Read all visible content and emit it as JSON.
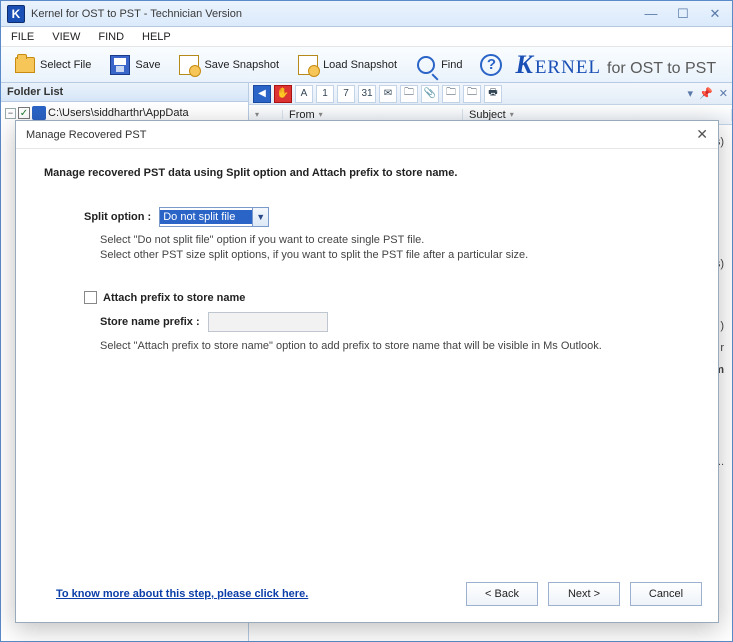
{
  "window": {
    "title": "Kernel for OST to PST - Technician Version",
    "app_icon_letter": "K"
  },
  "menu": {
    "items": [
      "FILE",
      "VIEW",
      "FIND",
      "HELP"
    ]
  },
  "toolbar": {
    "select_file": "Select File",
    "save": "Save",
    "save_snapshot": "Save Snapshot",
    "load_snapshot": "Load Snapshot",
    "find": "Find",
    "help_glyph": "?",
    "brand_first": "K",
    "brand_rest": "ERNEL",
    "brand_for": "for OST to PST"
  },
  "left_pane": {
    "header": "Folder List",
    "node_toggle": "−",
    "node_check": "✓",
    "node_text": "C:\\Users\\siddharthr\\AppData"
  },
  "right_pane": {
    "cols": {
      "from": "From",
      "subject": "Subject"
    },
    "ghost_items": [
      "iles)",
      "rvers)",
      "ino )",
      "r",
      "ed Em",
      "",
      "atlo..."
    ]
  },
  "mini_icons": [
    "◀",
    "✋",
    "A",
    "1",
    "7",
    "31",
    "✉",
    "🗀",
    "📎",
    "🗀",
    "🗀",
    "🖶"
  ],
  "rtools": [
    "▾",
    "📌",
    "✕"
  ],
  "dialog": {
    "title": "Manage Recovered PST",
    "heading": "Manage recovered PST data using Split option and Attach prefix to store name.",
    "split_label": "Split option :",
    "split_value": "Do not split file",
    "hint1_l1": "Select \"Do not split file\" option if you want to create single PST file.",
    "hint1_l2": "Select other PST size split options, if you want to split the PST file after a particular size.",
    "attach_prefix_label": "Attach prefix to store name",
    "store_prefix_label": "Store name prefix :",
    "hint2": "Select \"Attach prefix to store name\" option to add prefix to store name that will be visible in Ms Outlook.",
    "link": "To know more about this step, please click here.",
    "back": "< Back",
    "next": "Next >",
    "cancel": "Cancel"
  }
}
